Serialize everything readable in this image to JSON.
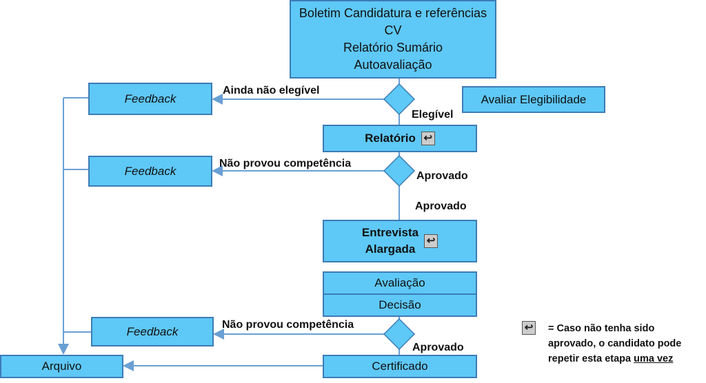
{
  "top_box": {
    "lines": [
      "Boletim Candidatura e referências",
      "CV",
      "Relatório Sumário",
      "Autoavaliação"
    ]
  },
  "avaliar": "Avaliar Elegibilidade",
  "feedback": [
    "Feedback",
    "Feedback",
    "Feedback"
  ],
  "labels": {
    "ainda": "Ainda não elegível",
    "elegivel": "Elegível",
    "nao1": "Não provou competência",
    "aprov1": "Aprovado",
    "aprov2": "Aprovado",
    "nao2": "Não provou competência",
    "aprov3": "Aprovado"
  },
  "relatorio": "Relatório",
  "entrevista": [
    "Entrevista",
    "Alargada"
  ],
  "avaliacao": "Avaliação",
  "decisao": "Decisão",
  "certificado": "Certificado",
  "arquivo": "Arquivo",
  "legend": {
    "icon": "repeat-return-icon",
    "line1": "= Caso não tenha sido",
    "line2": "aprovado, o candidato pode",
    "line3_prefix": "repetir esta etapa ",
    "line3_underlined": "uma vez"
  },
  "colors": {
    "box_fill": "#5ec8f7",
    "box_border": "#3d7cb5",
    "connector": "#6a9fd4"
  }
}
